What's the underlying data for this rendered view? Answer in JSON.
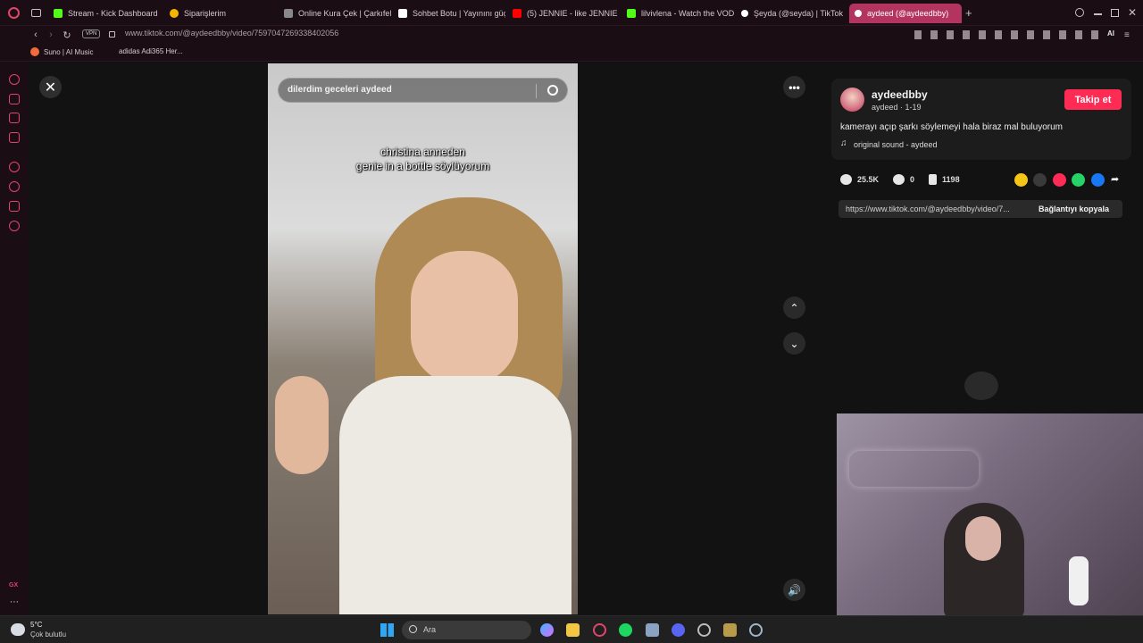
{
  "browser": {
    "tabs": [
      {
        "label": "Stream - Kick Dashboard",
        "color": "#53fc18"
      },
      {
        "label": "Siparişlerim",
        "color": "#f5b400"
      },
      {
        "label": "Online Kura Çek | Çarkıfel",
        "color": "#888888"
      },
      {
        "label": "Sohbet Botu | Yayınını güç",
        "color": "#ffffff"
      },
      {
        "label": "(5) JENNIE - like JENNIE (",
        "color": "#ff0000"
      },
      {
        "label": "lilvivlena - Watch the VOD",
        "color": "#53fc18"
      },
      {
        "label": "Şeyda (@seyda) | TikTok",
        "color": "#ffffff"
      },
      {
        "label": "aydeed (@aydeedbby)",
        "color": "#ffffff"
      }
    ],
    "url": "www.tiktok.com/@aydeedbby/video/7597047269338402056",
    "vpn_label": "VPN",
    "ai_label": "AI",
    "bookmarks": [
      {
        "label": "Suno | AI Music",
        "color": "#f26b3a"
      },
      {
        "label": "adidas Adi365 Her...",
        "color": "#1b0d14"
      }
    ],
    "sidebar_gx": "GX"
  },
  "video": {
    "search_text": "dilerdim geceleri aydeed",
    "caption_line1": "christina anneden",
    "caption_line2": "genie in a bottle söylüyorum"
  },
  "post": {
    "username": "aydeedbby",
    "subline": "aydeed · 1-19",
    "follow_label": "Takip et",
    "description": "kamerayı açıp şarkı söylemeyi hala biraz mal buluyorum",
    "sound": "original sound - aydeed",
    "likes": "25.5K",
    "comments": "0",
    "saves": "1198",
    "share_colors": [
      "#f5c518",
      "#3a3a3a",
      "#fe2c55",
      "#25d366",
      "#1877f2"
    ],
    "link": "https://www.tiktok.com/@aydeedbby/video/7...",
    "copy_label": "Bağlantıyı kopyala"
  },
  "taskbar": {
    "temperature": "5°C",
    "weather": "Çok bulutlu",
    "search_label": "Ara"
  }
}
